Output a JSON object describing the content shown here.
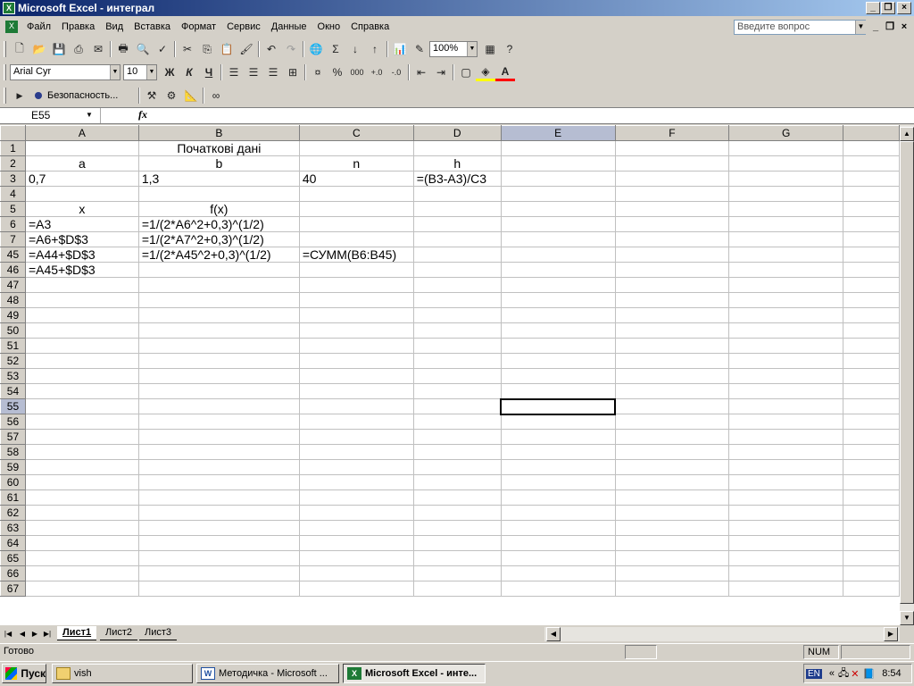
{
  "window": {
    "title": "Microsoft Excel - интеграл"
  },
  "menu": {
    "items": [
      "Файл",
      "Правка",
      "Вид",
      "Вставка",
      "Формат",
      "Сервис",
      "Данные",
      "Окно",
      "Справка"
    ],
    "ask_placeholder": "Введите вопрос"
  },
  "toolbar": {
    "zoom": "100%",
    "font_name": "Arial Cyr",
    "font_size": "10",
    "security_label": "Безопасность...",
    "bold": "Ж",
    "italic": "К",
    "underline": "Ч",
    "percent": "%",
    "thousands": "000"
  },
  "formula_bar": {
    "name_box": "E55",
    "fx": "fx",
    "formula": ""
  },
  "sheet": {
    "columns": [
      "A",
      "B",
      "C",
      "D",
      "E",
      "F",
      "G"
    ],
    "selected_column": "E",
    "selected_row": "55",
    "rows": [
      {
        "num": "1",
        "cells": [
          "",
          "Початкові дані",
          "",
          "",
          "",
          "",
          ""
        ]
      },
      {
        "num": "2",
        "cells": [
          "a",
          "b",
          "n",
          "h",
          "",
          "",
          ""
        ]
      },
      {
        "num": "3",
        "cells": [
          "0,7",
          "1,3",
          "40",
          "=(B3-A3)/C3",
          "",
          "",
          ""
        ]
      },
      {
        "num": "4",
        "cells": [
          "",
          "",
          "",
          "",
          "",
          "",
          ""
        ]
      },
      {
        "num": "5",
        "cells": [
          "x",
          "f(x)",
          "",
          "",
          "",
          "",
          ""
        ]
      },
      {
        "num": "6",
        "cells": [
          "=A3",
          "=1/(2*A6^2+0,3)^(1/2)",
          "",
          "",
          "",
          "",
          ""
        ]
      },
      {
        "num": "7",
        "cells": [
          "=A6+$D$3",
          "=1/(2*A7^2+0,3)^(1/2)",
          "",
          "",
          "",
          "",
          ""
        ]
      },
      {
        "num": "45",
        "cells": [
          "=A44+$D$3",
          "=1/(2*A45^2+0,3)^(1/2)",
          "=СУММ(B6:B45)",
          "",
          "",
          "",
          ""
        ]
      },
      {
        "num": "46",
        "cells": [
          "=A45+$D$3",
          "",
          "",
          "",
          "",
          "",
          ""
        ]
      },
      {
        "num": "47",
        "cells": [
          "",
          "",
          "",
          "",
          "",
          "",
          ""
        ]
      },
      {
        "num": "48",
        "cells": [
          "",
          "",
          "",
          "",
          "",
          "",
          ""
        ]
      },
      {
        "num": "49",
        "cells": [
          "",
          "",
          "",
          "",
          "",
          "",
          ""
        ]
      },
      {
        "num": "50",
        "cells": [
          "",
          "",
          "",
          "",
          "",
          "",
          ""
        ]
      },
      {
        "num": "51",
        "cells": [
          "",
          "",
          "",
          "",
          "",
          "",
          ""
        ]
      },
      {
        "num": "52",
        "cells": [
          "",
          "",
          "",
          "",
          "",
          "",
          ""
        ]
      },
      {
        "num": "53",
        "cells": [
          "",
          "",
          "",
          "",
          "",
          "",
          ""
        ]
      },
      {
        "num": "54",
        "cells": [
          "",
          "",
          "",
          "",
          "",
          "",
          ""
        ]
      },
      {
        "num": "55",
        "cells": [
          "",
          "",
          "",
          "",
          "",
          "",
          ""
        ]
      },
      {
        "num": "56",
        "cells": [
          "",
          "",
          "",
          "",
          "",
          "",
          ""
        ]
      },
      {
        "num": "57",
        "cells": [
          "",
          "",
          "",
          "",
          "",
          "",
          ""
        ]
      },
      {
        "num": "58",
        "cells": [
          "",
          "",
          "",
          "",
          "",
          "",
          ""
        ]
      },
      {
        "num": "59",
        "cells": [
          "",
          "",
          "",
          "",
          "",
          "",
          ""
        ]
      },
      {
        "num": "60",
        "cells": [
          "",
          "",
          "",
          "",
          "",
          "",
          ""
        ]
      },
      {
        "num": "61",
        "cells": [
          "",
          "",
          "",
          "",
          "",
          "",
          ""
        ]
      },
      {
        "num": "62",
        "cells": [
          "",
          "",
          "",
          "",
          "",
          "",
          ""
        ]
      },
      {
        "num": "63",
        "cells": [
          "",
          "",
          "",
          "",
          "",
          "",
          ""
        ]
      },
      {
        "num": "64",
        "cells": [
          "",
          "",
          "",
          "",
          "",
          "",
          ""
        ]
      },
      {
        "num": "65",
        "cells": [
          "",
          "",
          "",
          "",
          "",
          "",
          ""
        ]
      },
      {
        "num": "66",
        "cells": [
          "",
          "",
          "",
          "",
          "",
          "",
          ""
        ]
      },
      {
        "num": "67",
        "cells": [
          "",
          "",
          "",
          "",
          "",
          "",
          ""
        ]
      }
    ],
    "tabs": [
      "Лист1",
      "Лист2",
      "Лист3"
    ],
    "active_tab": "Лист1"
  },
  "status": {
    "ready": "Готово",
    "num": "NUM"
  },
  "taskbar": {
    "start": "Пуск",
    "buttons": [
      "vish",
      "Методичка - Microsoft ...",
      "Microsoft Excel - инте..."
    ],
    "lang": "EN",
    "time": "8:54"
  },
  "colors": {
    "title_start": "#0a246a",
    "title_end": "#a6caf0",
    "chrome": "#d4d0c8",
    "excel_green": "#1e7a36"
  }
}
